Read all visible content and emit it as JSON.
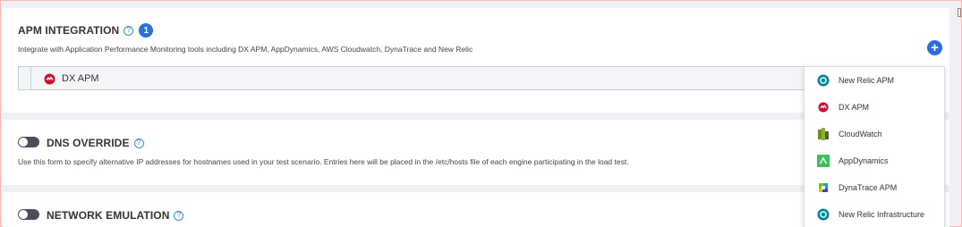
{
  "apm": {
    "title": "APM INTEGRATION",
    "count": "1",
    "description": "Integrate with Application Performance Monitoring tools including DX APM, AppDynamics, AWS Cloudwatch, DynaTrace and New Relic",
    "row_label": "DX APM",
    "add_label": "+"
  },
  "dns": {
    "title": "DNS OVERRIDE",
    "description": "Use this form to specify alternative IP addresses for hostnames used in your test scenario. Entries here will be placed in the /etc/hosts file of each engine participating in the load test.",
    "enabled": false
  },
  "network": {
    "title": "NETWORK EMULATION",
    "enabled": false
  },
  "help_glyph": "?",
  "dropdown": {
    "items": [
      {
        "label": "New Relic APM",
        "icon": "new-relic-icon"
      },
      {
        "label": "DX APM",
        "icon": "dx-apm-icon"
      },
      {
        "label": "CloudWatch",
        "icon": "cloudwatch-icon"
      },
      {
        "label": "AppDynamics",
        "icon": "appdynamics-icon"
      },
      {
        "label": "DynaTrace APM",
        "icon": "dynatrace-icon"
      },
      {
        "label": "New Relic Infrastructure",
        "icon": "new-relic-icon"
      }
    ]
  },
  "colors": {
    "accent": "#2d6fd8",
    "dx_red": "#c8102e",
    "new_relic": "#1ce783",
    "appdynamics": "#3fbf5c"
  }
}
